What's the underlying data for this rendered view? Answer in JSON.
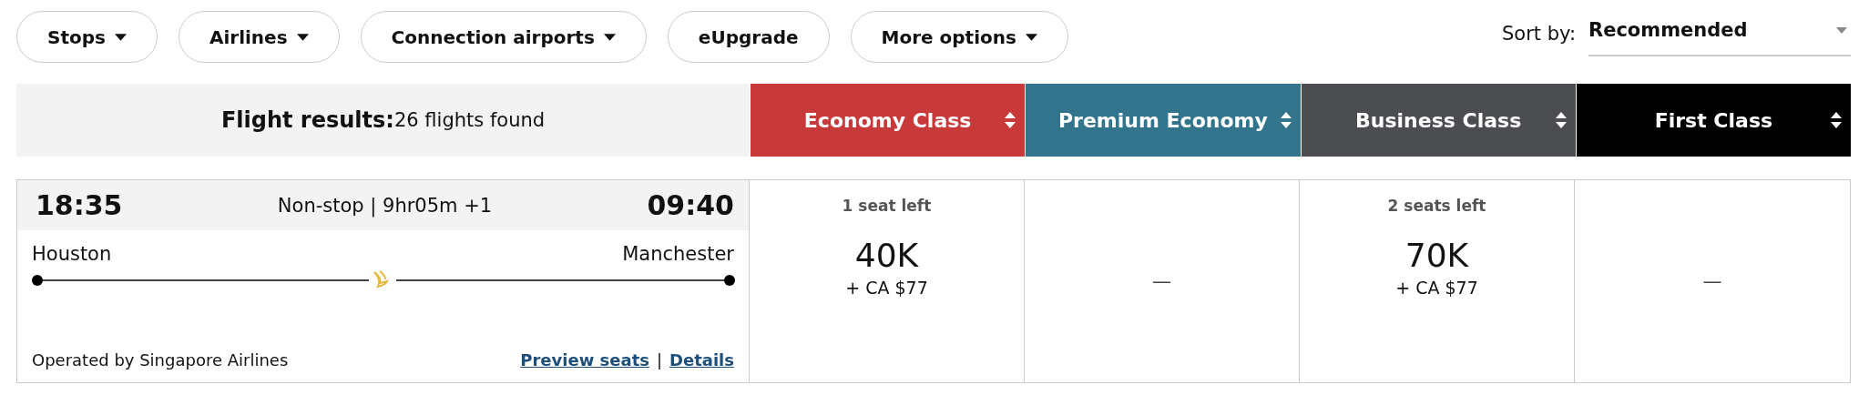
{
  "filters": [
    {
      "label": "Stops",
      "dropdown": true
    },
    {
      "label": "Airlines",
      "dropdown": true
    },
    {
      "label": "Connection airports",
      "dropdown": true
    },
    {
      "label": "eUpgrade",
      "dropdown": false
    },
    {
      "label": "More options",
      "dropdown": true
    }
  ],
  "sort": {
    "label": "Sort by:",
    "value": "Recommended"
  },
  "results": {
    "title": "Flight results:",
    "count": "26 flights found"
  },
  "cabins": [
    {
      "label": "Economy Class",
      "color": "#c83a3a"
    },
    {
      "label": "Premium Economy",
      "color": "#32748c"
    },
    {
      "label": "Business Class",
      "color": "#4b4d51"
    },
    {
      "label": "First Class",
      "color": "#000000"
    }
  ],
  "flight": {
    "depart_time": "18:35",
    "summary": "Non-stop | 9hr05m +1",
    "arrive_time": "09:40",
    "origin": "Houston",
    "destination": "Manchester",
    "operator": "Operated by Singapore Airlines",
    "links": [
      "Preview seats",
      "Details"
    ],
    "separator": "|"
  },
  "fares": [
    {
      "kind": "fare",
      "seats": "1 seat left",
      "points": "40K",
      "taxes": "+ CA $77"
    },
    {
      "kind": "none",
      "text": "—"
    },
    {
      "kind": "fare",
      "seats": "2 seats left",
      "points": "70K",
      "taxes": "+ CA $77"
    },
    {
      "kind": "none",
      "text": "—"
    }
  ]
}
